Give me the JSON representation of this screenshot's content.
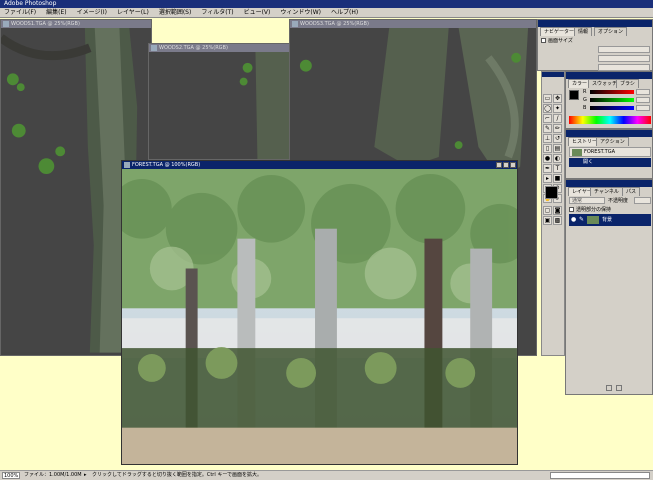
{
  "app": {
    "title": "Adobe Photoshop"
  },
  "menu": [
    "ファイル(F)",
    "編集(E)",
    "イメージ(I)",
    "レイヤー(L)",
    "選択範囲(S)",
    "フィルタ(T)",
    "ビュー(V)",
    "ウィンドウ(W)",
    "ヘルプ(H)"
  ],
  "windows": {
    "doc1": "WOODS1.TGA @ 25%(RGB)",
    "doc2": "WOODS2.TGA @ 25%(RGB)",
    "doc3": "WOODS3.TGA @ 25%(RGB)",
    "main": "FOREST.TGA @ 100%(RGB)"
  },
  "navigator": {
    "tabs": [
      "ナビゲーター",
      "情報",
      "オプション"
    ],
    "checkbox_label": "画面サイズ"
  },
  "color": {
    "tabs": [
      "カラー",
      "スウォッチ",
      "ブラシ"
    ],
    "channels": [
      "R",
      "G",
      "B"
    ]
  },
  "history": {
    "tabs": [
      "ヒストリー",
      "アクション"
    ],
    "snapshot": "FOREST.TGA",
    "step": "開く"
  },
  "layers": {
    "tabs": [
      "レイヤー",
      "チャンネル",
      "パス"
    ],
    "mode": "通常",
    "opacity_label": "不透明度",
    "preserve_label": "透明部分の保持",
    "layer_name": "背景"
  },
  "status": {
    "zoom": "100%",
    "doc_size": "ファイル：1.00M/1.00M",
    "hint": "クリックしてドラッグすると切り抜く範囲を指定。Ctrl キーで画面を拡大。"
  },
  "colors": {
    "titlebar_active": "#0a246a",
    "background": "#ffffc8",
    "chrome": "#d4d0c8"
  }
}
